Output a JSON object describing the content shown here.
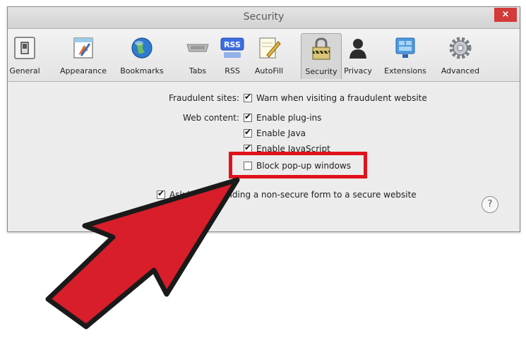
{
  "window": {
    "title": "Security",
    "close_label": "×"
  },
  "toolbar": {
    "tabs": [
      {
        "label": "General",
        "icon": "general-switch-icon"
      },
      {
        "label": "Appearance",
        "icon": "appearance-icon"
      },
      {
        "label": "Bookmarks",
        "icon": "globe-icon"
      },
      {
        "label": "Tabs",
        "icon": "tabs-icon"
      },
      {
        "label": "RSS",
        "icon": "rss-icon",
        "icon_text": "RSS"
      },
      {
        "label": "AutoFill",
        "icon": "pencil-icon"
      },
      {
        "label": "Security",
        "icon": "lock-icon",
        "active": true
      },
      {
        "label": "Privacy",
        "icon": "person-icon"
      },
      {
        "label": "Extensions",
        "icon": "puzzle-icon"
      },
      {
        "label": "Advanced",
        "icon": "gear-icon"
      }
    ]
  },
  "security": {
    "fraudulent_label": "Fraudulent sites:",
    "fraudulent_option": "Warn when visiting a fraudulent website",
    "web_content_label": "Web content:",
    "plugins": "Enable plug-ins",
    "java": "Enable Java",
    "javascript": "Enable JavaScript",
    "popups": "Block pop-up windows",
    "ask_text": "Ask before sending a non-secure form to a secure website",
    "checks": {
      "fraud": true,
      "plugins": true,
      "java": true,
      "javascript": true,
      "popups": false,
      "ask": true
    }
  },
  "help_label": "?",
  "colors": {
    "highlight": "#e0121b",
    "arrow": "#d81e2a",
    "close": "#d33a3a"
  }
}
